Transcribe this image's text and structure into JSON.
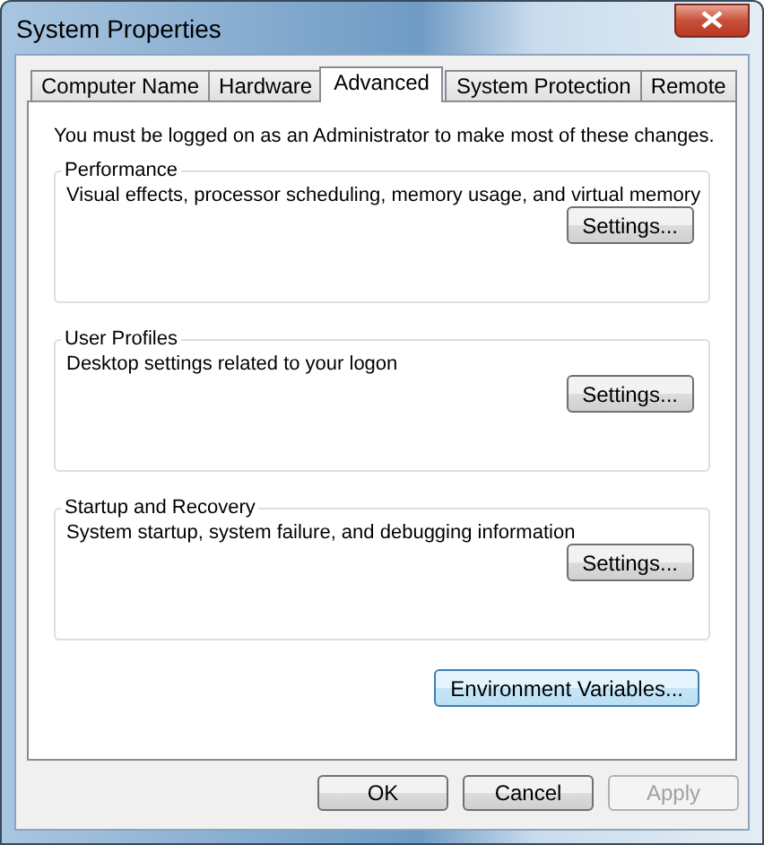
{
  "window": {
    "title": "System Properties"
  },
  "tabs": [
    {
      "label": "Computer Name",
      "selected": false
    },
    {
      "label": "Hardware",
      "selected": false
    },
    {
      "label": "Advanced",
      "selected": true
    },
    {
      "label": "System Protection",
      "selected": false
    },
    {
      "label": "Remote",
      "selected": false
    }
  ],
  "notice": "You must be logged on as an Administrator to make most of these changes.",
  "groups": [
    {
      "title": "Performance",
      "description": "Visual effects, processor scheduling, memory usage, and virtual memory",
      "button": "Settings..."
    },
    {
      "title": "User Profiles",
      "description": "Desktop settings related to your logon",
      "button": "Settings..."
    },
    {
      "title": "Startup and Recovery",
      "description": "System startup, system failure, and debugging information",
      "button": "Settings..."
    }
  ],
  "environment_button": {
    "label": "Environment Variables...",
    "focused": true
  },
  "buttons": [
    {
      "label": "OK",
      "disabled": false
    },
    {
      "label": "Cancel",
      "disabled": false
    },
    {
      "label": "Apply",
      "disabled": true
    }
  ]
}
